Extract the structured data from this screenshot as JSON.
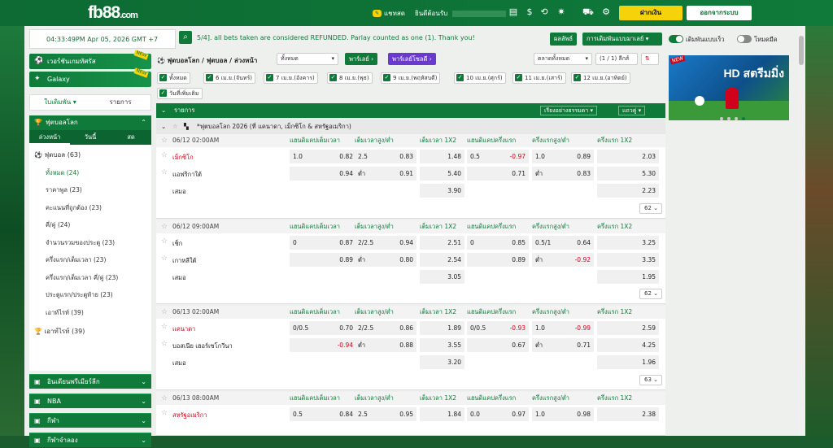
{
  "topbar": {
    "logo": "fb88",
    "logo_suffix": ".com",
    "chat": "แชทสด",
    "welcome": "ยินดีต้อนรับ",
    "deposit": "ฝากเงิน",
    "logout": "ออกจากระบบ"
  },
  "clock": "04:33:49PM Apr 05, 2026 GMT +7",
  "marquee": "5/4]. all bets taken are considered REFUNDED. Parlay counted as one (1). Thank you!",
  "options": {
    "profile": "ผลลัพธ์",
    "odds_type": "การเดิมพันแบบมาเลย์",
    "quick_bet": "เดิมพันแบบเร็ว",
    "dark_mode": "โหมดมืด"
  },
  "left": {
    "virtual": "เวอร์ชันเกมทัศรัส",
    "galaxy": "Galaxy",
    "new": "NEW",
    "tab_bet": "ใบเดิมพัน",
    "tab_list": "รายการ",
    "sport_head": "ฟุตบอลโลก",
    "sub": [
      "ล่วงหน้า",
      "วันนี้",
      "สด"
    ],
    "sport_line": "ฟุตบอล (63)",
    "items": [
      "ทั้งหมด (24)",
      "ราคาพูล (23)",
      "คะแนนที่ถูกต้อง (23)",
      "คี่/คู่ (24)",
      "จำนวนรวมของประตู (23)",
      "ครึ่งแรก/เต็มเวลา (23)",
      "ครึ่งแรก/เต็มเวลา คี่/คู่ (23)",
      "ประตูแรก/ประตูท้าย (23)",
      "เอาท์ไรท์ (39)"
    ],
    "outright": "เอาท์ไรท์ (39)",
    "sections": [
      "อินเดียนพรีเมียร์ลีก",
      "NBA",
      "กีฬา",
      "กีฬาจำลอง"
    ]
  },
  "center": {
    "breadcrumb": "ฟุตบอลโลก / ฟุตบอล / ล่วงหน้า",
    "filter_all": "ทั้งหมด",
    "parlay": "พาร์เลย์",
    "parlay_special": "พาร์เลย์โซลดี",
    "market": "ตลาดทั้งหมด",
    "page": "(1 / 1) ลีกส์",
    "dates": [
      "ทั้งหมด",
      "6 เม.ย.(จันทร์)",
      "7 เม.ย.(อังคาร)",
      "8 เม.ย.(พุธ)",
      "9 เม.ย.(พฤหัสบดี)",
      "10 เม.ย.(ศุกร์)",
      "11 เม.ย.(เสาร์)",
      "12 เม.ย.(อาทิตย์)"
    ],
    "more_date": "วันที่เพิ่มเติม",
    "list_label": "รายการ",
    "sort": "เรียงอย่างธรรมดา",
    "view": "แถวคู่",
    "league": "*ฟุตบอลโลก 2026 (ที่ แคนาดา, เม็กซิโก & สหรัฐอเมริกา)",
    "cols": [
      "แฮนดิแคปเต็มเวลา",
      "เต็มเวลาสูง/ต่ำ",
      "เต็มเวลา 1X2",
      "แฮนดิแคปครึ่งแรก",
      "ครึ่งแรกสูง/ต่ำ",
      "ครึ่งแรก 1X2"
    ],
    "draw": "เสมอ",
    "under": "ต่ำ"
  },
  "matches": [
    {
      "time": "06/12 02:00AM",
      "home": "เม็กซิโก",
      "away": "แอฟริกาใต้",
      "home_red": true,
      "away_red": false,
      "r1": [
        "1.0",
        "0.82",
        "2.5",
        "0.83",
        "1.48",
        "0.5",
        "-0.97",
        "1.0",
        "0.89",
        "2.03"
      ],
      "r2": [
        "",
        "0.94",
        "ต่ำ",
        "0.91",
        "5.40",
        "",
        "0.71",
        "ต่ำ",
        "0.83",
        "5.30"
      ],
      "r3": [
        "3.90",
        "2.23"
      ],
      "more": "62"
    },
    {
      "time": "06/12 09:00AM",
      "home": "เช็ก",
      "away": "เกาหลีใต้",
      "home_red": false,
      "away_red": false,
      "r1": [
        "0",
        "0.87",
        "2/2.5",
        "0.94",
        "2.51",
        "0",
        "0.85",
        "0.5/1",
        "0.64",
        "3.25"
      ],
      "r2": [
        "",
        "0.89",
        "ต่ำ",
        "0.80",
        "2.54",
        "",
        "0.89",
        "ต่ำ",
        "-0.92",
        "3.35"
      ],
      "r3": [
        "3.05",
        "1.95"
      ],
      "more": "62"
    },
    {
      "time": "06/13 02:00AM",
      "home": "แคนาดา",
      "away": "บอสเนีย เฮอร์เซโกวีนา",
      "home_red": true,
      "away_red": false,
      "r1": [
        "0/0.5",
        "0.70",
        "2/2.5",
        "0.86",
        "1.89",
        "0/0.5",
        "-0.93",
        "1.0",
        "-0.99",
        "2.59"
      ],
      "r2": [
        "",
        "-0.94",
        "ต่ำ",
        "0.88",
        "3.55",
        "",
        "0.67",
        "ต่ำ",
        "0.71",
        "4.25"
      ],
      "r3": [
        "3.20",
        "1.96"
      ],
      "more": "63"
    },
    {
      "time": "06/13 08:00AM",
      "home": "สหรัฐอเมริกา",
      "away": "",
      "home_red": true,
      "away_red": false,
      "r1": [
        "0.5",
        "0.84",
        "2.5",
        "0.95",
        "1.84",
        "0.0",
        "0.97",
        "1.0",
        "0.98",
        "2.38"
      ],
      "r2": [],
      "r3": [],
      "more": ""
    }
  ],
  "banner": {
    "new": "NEW",
    "text": "HD สตรีมมิ่ง"
  }
}
